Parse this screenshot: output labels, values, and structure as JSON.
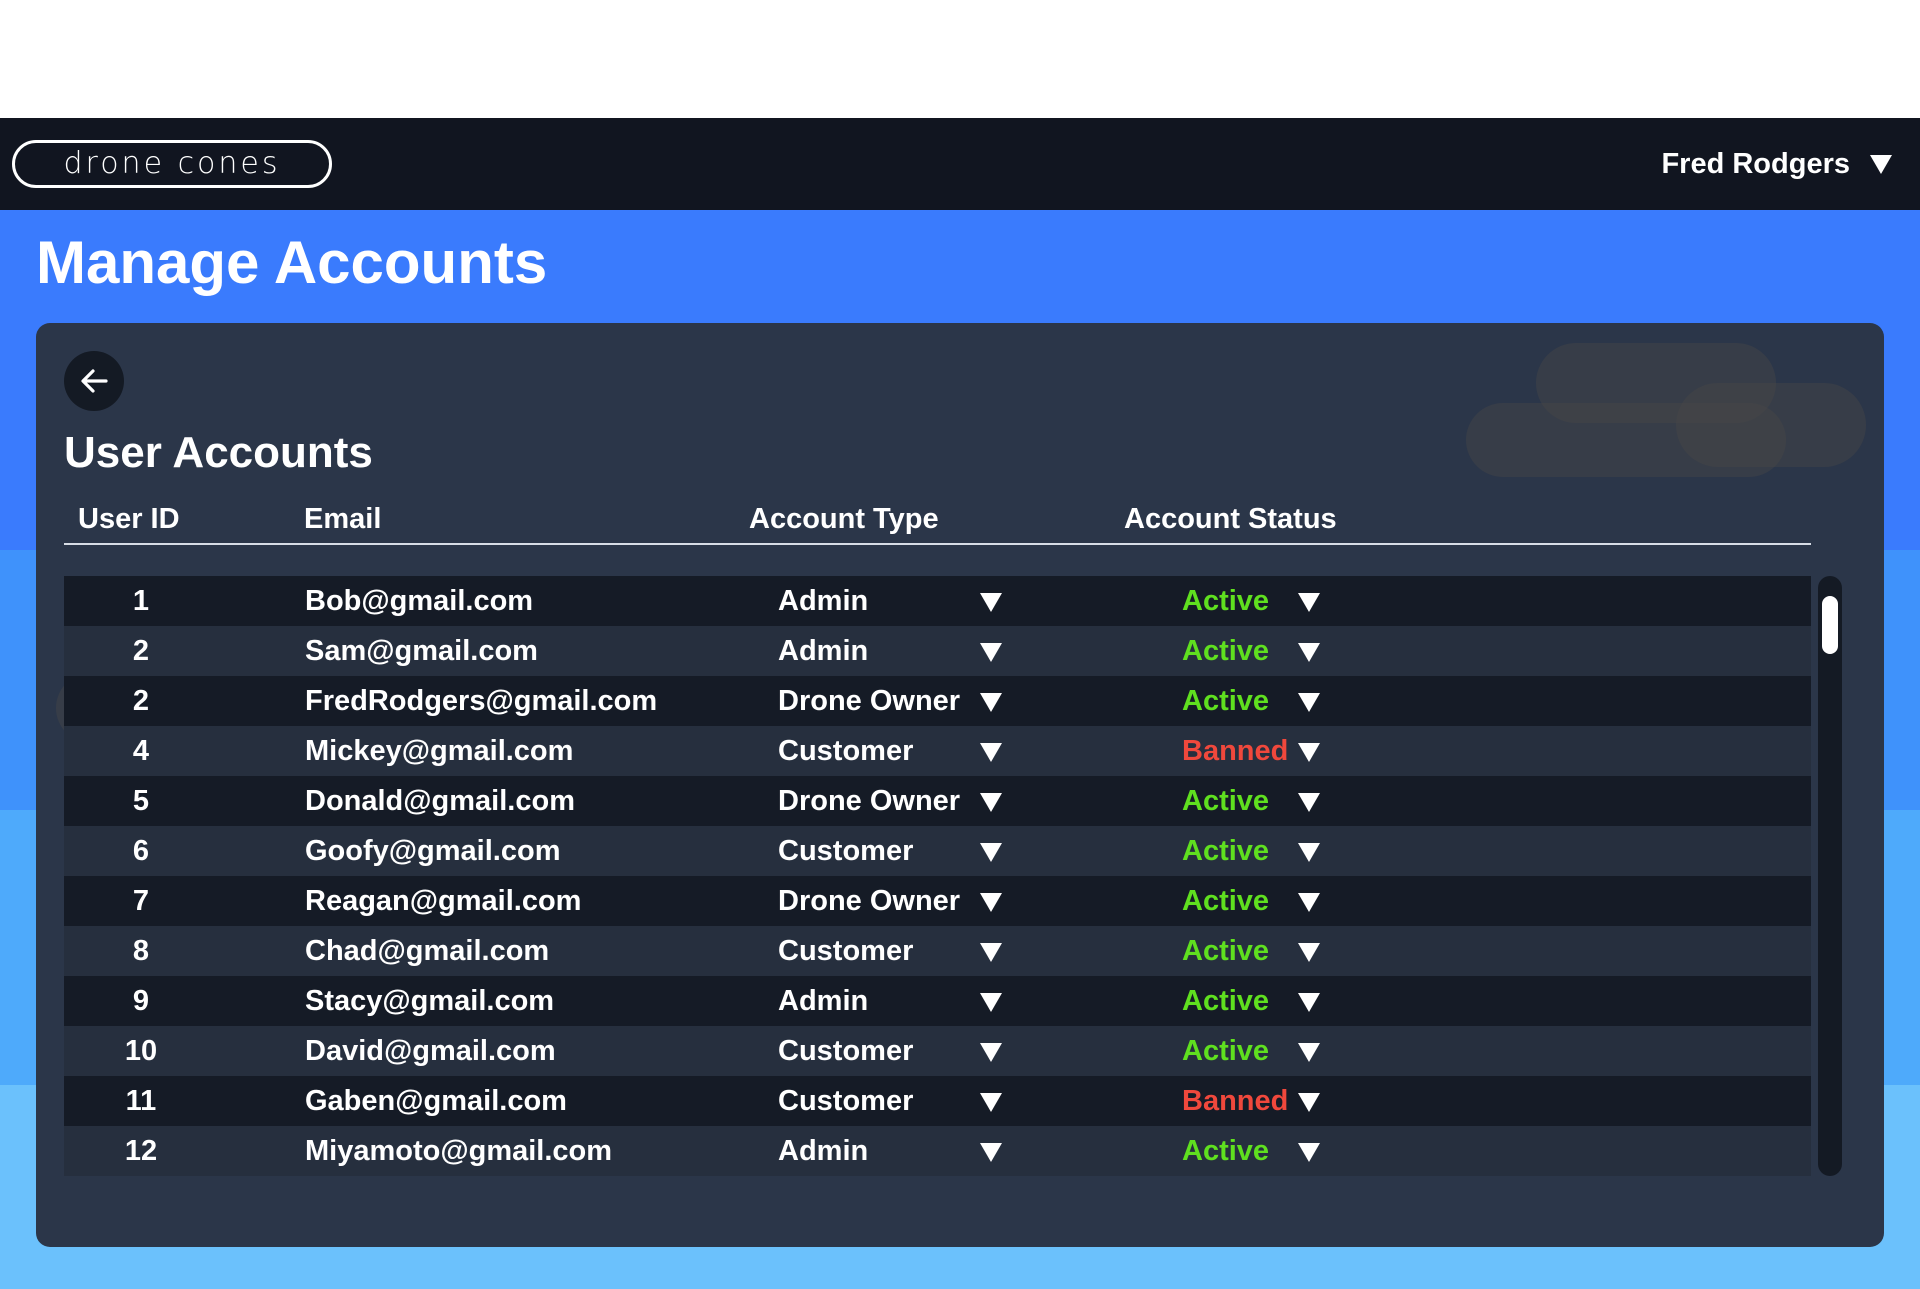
{
  "app": {
    "logo_text": "drone cones",
    "user_name": "Fred Rodgers"
  },
  "page": {
    "title": "Manage Accounts"
  },
  "panel": {
    "title": "User Accounts",
    "columns": {
      "user_id": "User ID",
      "email": "Email",
      "account_type": "Account Type",
      "account_status": "Account Status"
    },
    "rows": [
      {
        "id": "1",
        "email": "Bob@gmail.com",
        "type": "Admin",
        "status": "Active"
      },
      {
        "id": "2",
        "email": "Sam@gmail.com",
        "type": "Admin",
        "status": "Active"
      },
      {
        "id": "2",
        "email": "FredRodgers@gmail.com",
        "type": "Drone Owner",
        "status": "Active"
      },
      {
        "id": "4",
        "email": "Mickey@gmail.com",
        "type": "Customer",
        "status": "Banned"
      },
      {
        "id": "5",
        "email": "Donald@gmail.com",
        "type": "Drone Owner",
        "status": "Active"
      },
      {
        "id": "6",
        "email": "Goofy@gmail.com",
        "type": "Customer",
        "status": "Active"
      },
      {
        "id": "7",
        "email": "Reagan@gmail.com",
        "type": "Drone Owner",
        "status": "Active"
      },
      {
        "id": "8",
        "email": "Chad@gmail.com",
        "type": "Customer",
        "status": "Active"
      },
      {
        "id": "9",
        "email": "Stacy@gmail.com",
        "type": "Admin",
        "status": "Active"
      },
      {
        "id": "10",
        "email": "David@gmail.com",
        "type": "Customer",
        "status": "Active"
      },
      {
        "id": "11",
        "email": "Gaben@gmail.com",
        "type": "Customer",
        "status": "Banned"
      },
      {
        "id": "12",
        "email": "Miyamoto@gmail.com",
        "type": "Admin",
        "status": "Active"
      }
    ]
  },
  "colors": {
    "active": "#5fe01f",
    "banned": "#f0483c",
    "topbar": "#111520",
    "panel": "#2b3649"
  },
  "icons": {
    "back": "arrow-left-icon",
    "dropdown": "triangle-down-icon"
  }
}
